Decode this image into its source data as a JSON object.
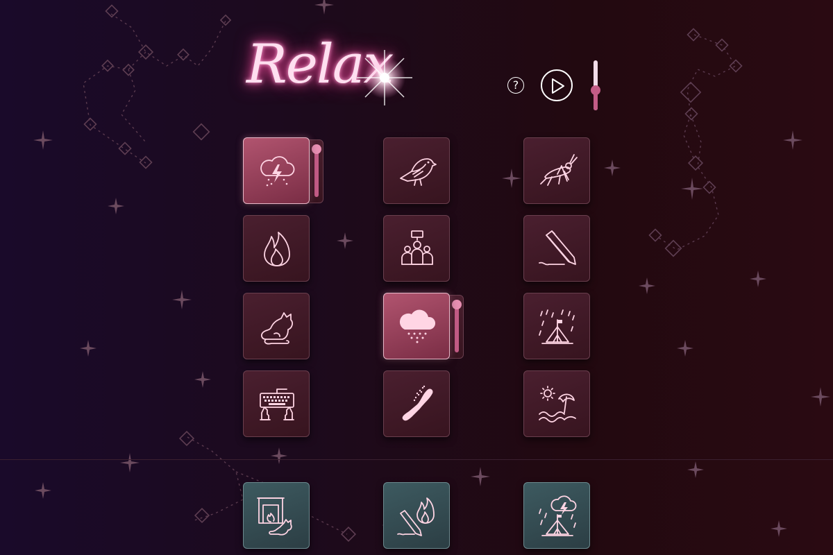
{
  "app": {
    "title": "Relax",
    "help_label": "?",
    "master_volume": 0.45
  },
  "colors": {
    "accent": "#c35c86",
    "icon_stroke": "#ffd5e4",
    "tile_bg": "#3f1826",
    "tile_active_bg": "#a34765",
    "combo_tile_bg": "#375056"
  },
  "sounds": [
    {
      "icon": "thunderstorm-icon",
      "active": true,
      "volume": 1.0
    },
    {
      "icon": "bird-icon",
      "active": false
    },
    {
      "icon": "cricket-icon",
      "active": false
    },
    {
      "icon": "fire-icon",
      "active": false
    },
    {
      "icon": "crowd-chatter-icon",
      "active": false
    },
    {
      "icon": "pencil-writing-icon",
      "active": false
    },
    {
      "icon": "cat-purring-icon",
      "active": false
    },
    {
      "icon": "rain-cloud-icon",
      "active": true,
      "volume": 1.0
    },
    {
      "icon": "rain-on-tent-icon",
      "active": false
    },
    {
      "icon": "keyboard-typing-icon",
      "active": false
    },
    {
      "icon": "hair-brush-icon",
      "active": false
    },
    {
      "icon": "beach-waves-icon",
      "active": false
    }
  ],
  "presets": [
    {
      "icon": "fireplace-cat-icon"
    },
    {
      "icon": "pencil-fire-icon"
    },
    {
      "icon": "storm-tent-icon"
    }
  ]
}
